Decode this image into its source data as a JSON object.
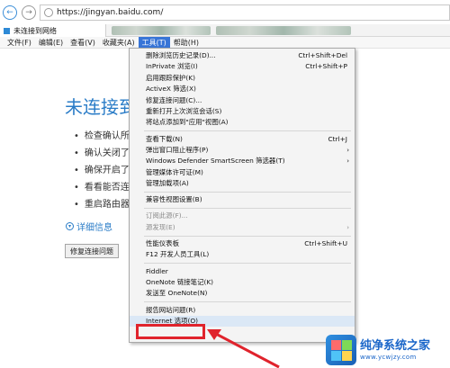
{
  "address_bar": {
    "url": "https://jingyan.baidu.com/"
  },
  "tab": {
    "title": "未连接到网络"
  },
  "menu_bar": [
    "文件(F)",
    "编辑(E)",
    "查看(V)",
    "收藏夹(A)",
    "工具(T)",
    "帮助(H)"
  ],
  "active_menu": "工具(T)",
  "page": {
    "title": "未连接到",
    "bullets": [
      "检查确认所",
      "确认关闭了",
      "确保开启了",
      "看看能否连",
      "重启路由器"
    ],
    "details_label": "详细信息",
    "fix_button": "修复连接问题"
  },
  "tools_menu": [
    {
      "label": "删除浏览历史记录(D)...",
      "shortcut": "Ctrl+Shift+Del"
    },
    {
      "label": "InPrivate 浏览(I)",
      "shortcut": "Ctrl+Shift+P"
    },
    {
      "label": "启用跟踪保护(K)",
      "shortcut": ""
    },
    {
      "label": "ActiveX 筛选(X)",
      "shortcut": ""
    },
    {
      "label": "修复连接问题(C)...",
      "shortcut": ""
    },
    {
      "label": "重新打开上次浏览会话(S)",
      "shortcut": ""
    },
    {
      "label": "将站点添加到\"应用\"视图(A)",
      "shortcut": ""
    },
    {
      "sep": true
    },
    {
      "label": "查看下载(N)",
      "shortcut": "Ctrl+J"
    },
    {
      "label": "弹出窗口阻止程序(P)",
      "shortcut": "",
      "submenu": true
    },
    {
      "label": "Windows Defender SmartScreen 筛选器(T)",
      "shortcut": "",
      "submenu": true
    },
    {
      "label": "管理媒体许可证(M)",
      "shortcut": ""
    },
    {
      "label": "管理加载项(A)",
      "shortcut": ""
    },
    {
      "sep": true
    },
    {
      "label": "兼容性视图设置(B)",
      "shortcut": ""
    },
    {
      "sep": true
    },
    {
      "label": "订阅此源(F)...",
      "shortcut": "",
      "disabled": true
    },
    {
      "label": "源发现(E)",
      "shortcut": "",
      "disabled": true,
      "submenu": true
    },
    {
      "sep": true
    },
    {
      "label": "性能仪表板",
      "shortcut": "Ctrl+Shift+U"
    },
    {
      "label": "F12 开发人员工具(L)",
      "shortcut": ""
    },
    {
      "sep": true
    },
    {
      "label": "Fiddler",
      "shortcut": ""
    },
    {
      "label": "OneNote 链接笔记(K)",
      "shortcut": ""
    },
    {
      "label": "发送至 OneNote(N)",
      "shortcut": ""
    },
    {
      "sep": true
    },
    {
      "label": "报告网站问题(R)",
      "shortcut": ""
    },
    {
      "label": "Internet 选项(O)",
      "shortcut": "",
      "highlight": true
    }
  ],
  "watermark": {
    "title": "纯净系统之家",
    "url": "www.ycwjzy.com"
  },
  "colors": {
    "accent": "#2a7cc7",
    "menu_active": "#3875d7",
    "annotation": "#e0232c"
  }
}
